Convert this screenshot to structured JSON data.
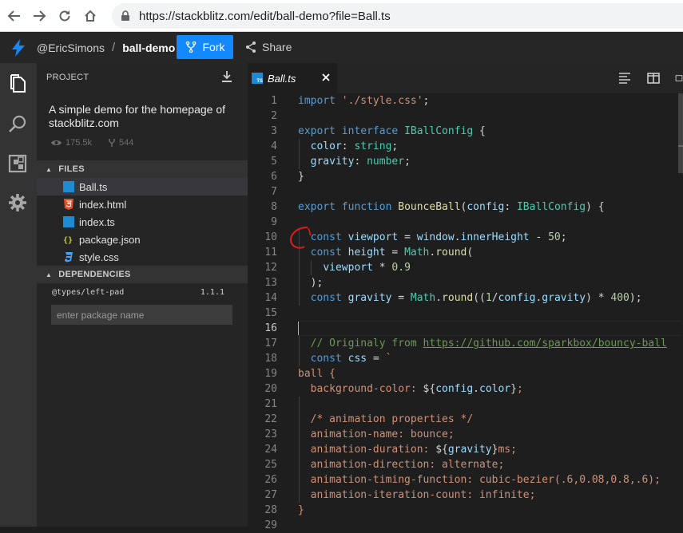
{
  "browser": {
    "url": "https://stackblitz.com/edit/ball-demo?file=Ball.ts"
  },
  "header": {
    "owner": "@EricSimons",
    "separator": "/",
    "project": "ball-demo",
    "fork_label": "Fork",
    "share_label": "Share"
  },
  "sidebar": {
    "project_heading": "PROJECT",
    "description": "A simple demo for the homepage of stackblitz.com",
    "views": "175.5k",
    "forks": "544",
    "files_heading": "FILES",
    "files": [
      {
        "name": "Ball.ts",
        "type": "ts",
        "color": "#1f8ad2"
      },
      {
        "name": "index.html",
        "type": "html",
        "color": "#e44d26"
      },
      {
        "name": "index.ts",
        "type": "ts",
        "color": "#1f8ad2"
      },
      {
        "name": "package.json",
        "type": "json",
        "color": "#cbcb41"
      },
      {
        "name": "style.css",
        "type": "css",
        "color": "#42a5f5"
      }
    ],
    "deps_heading": "DEPENDENCIES",
    "dependency": {
      "name": "@types/left-pad",
      "version": "1.1.1"
    },
    "package_placeholder": "enter package name"
  },
  "editor": {
    "tab_label": "Ball.ts",
    "ts_badge": "TS",
    "current_line": 16,
    "line_numbers": [
      "1",
      "2",
      "3",
      "4",
      "5",
      "6",
      "7",
      "8",
      "9",
      "10",
      "11",
      "12",
      "13",
      "14",
      "15",
      "16",
      "17",
      "18",
      "19",
      "20",
      "21",
      "22",
      "23",
      "24",
      "25",
      "26",
      "27",
      "28",
      "29"
    ]
  },
  "colors": {
    "accent": "#1389fd",
    "annotation": "#e01b1b"
  }
}
